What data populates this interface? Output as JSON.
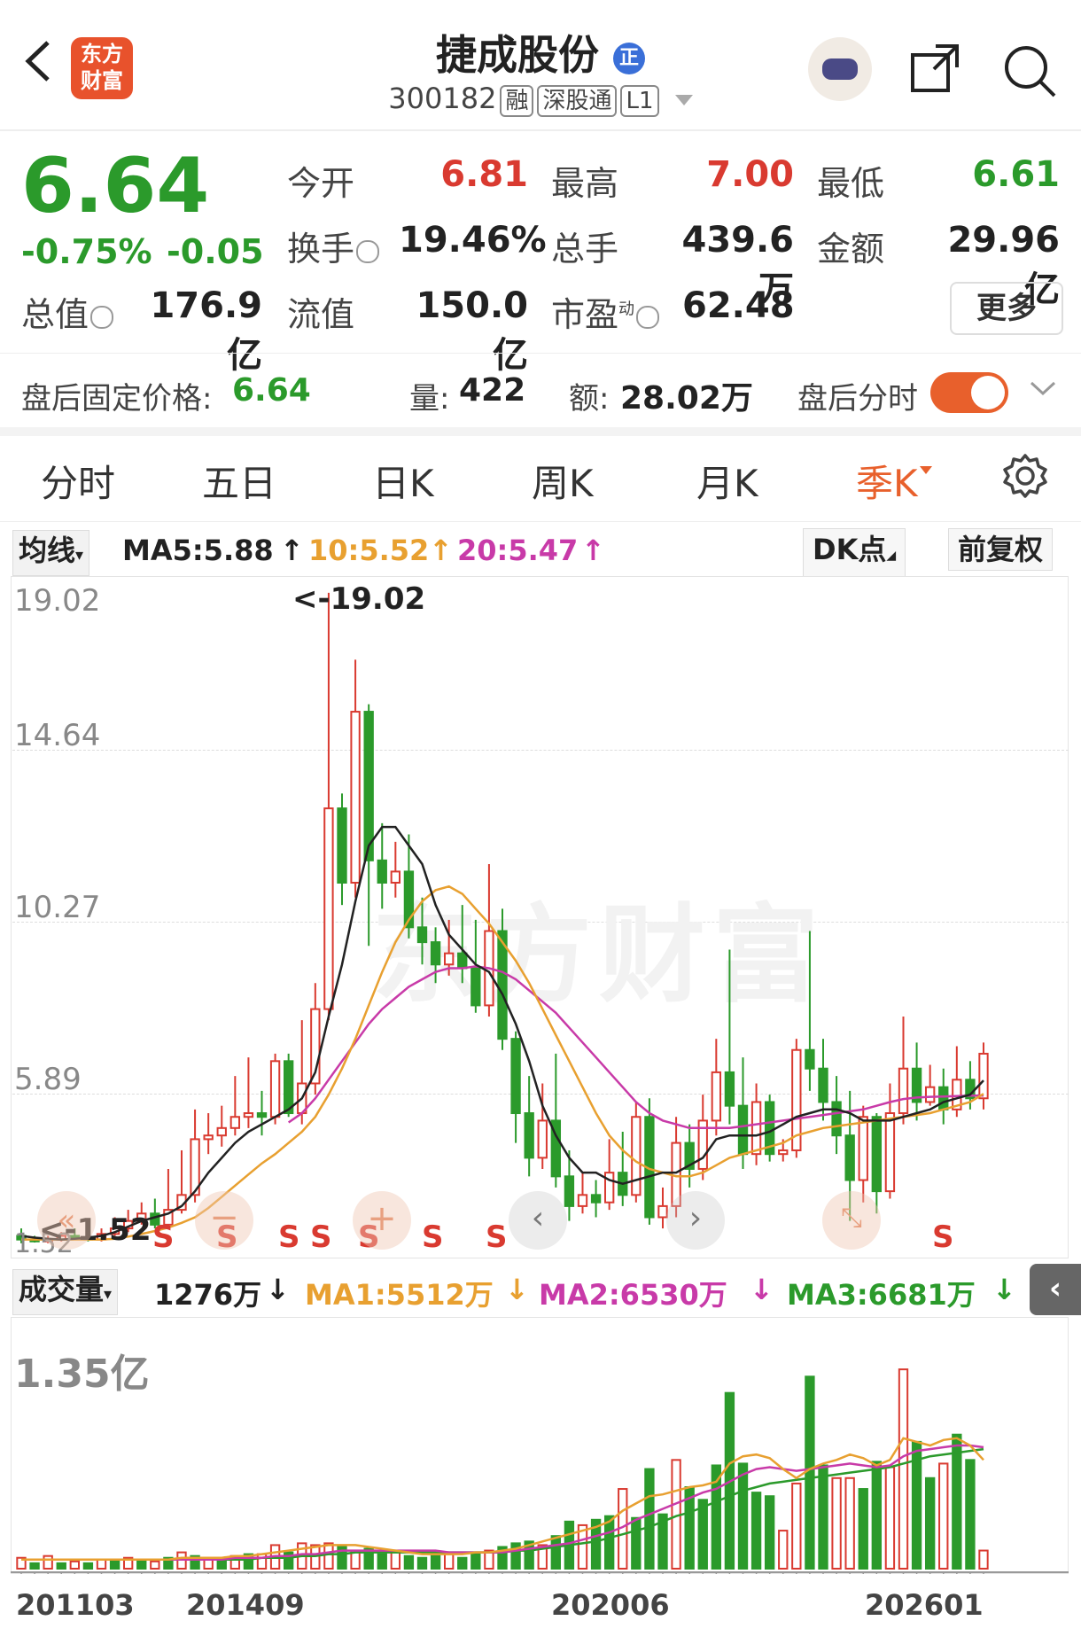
{
  "header": {
    "title": "捷成股份",
    "badge": "正",
    "code": "300182",
    "tags": [
      "融",
      "深股通",
      "L1"
    ],
    "logo_text": "东方财富"
  },
  "quote": {
    "price": "6.64",
    "change_pct": "-0.75%",
    "change": "-0.05",
    "rows": [
      [
        {
          "label": "今开",
          "value": "6.81",
          "color": "red"
        },
        {
          "label": "最高",
          "value": "7.00",
          "color": "red"
        },
        {
          "label": "最低",
          "value": "6.61",
          "color": "green"
        }
      ],
      [
        {
          "label": "换手",
          "value": "19.46%",
          "color": "black"
        },
        {
          "label": "总手",
          "value": "439.6万",
          "color": "black"
        },
        {
          "label": "金额",
          "value": "29.96亿",
          "color": "black"
        }
      ]
    ],
    "total_cap_label": "总值",
    "total_cap": "176.9亿",
    "float_cap_label": "流值",
    "float_cap": "150.0亿",
    "pe_label": "市盈",
    "pe_sup": "动",
    "pe": "62.48",
    "more": "更多"
  },
  "after_hours": {
    "price_label": "盘后固定价格:",
    "price": "6.64",
    "vol_label": "量:",
    "vol": "422",
    "amt_label": "额:",
    "amt": "28.02万",
    "toggle_label": "盘后分时"
  },
  "tabs": [
    "分时",
    "五日",
    "日K",
    "周K",
    "月K",
    "季K"
  ],
  "active_tab": "季K",
  "ma_bar": {
    "selector": "均线",
    "ma5": "MA5:5.88",
    "ma10": "10:5.52",
    "ma20": "20:5.47",
    "dk": "DK点",
    "fq": "前复权"
  },
  "vol_bar": {
    "selector": "成交量",
    "vol": "1276万",
    "ma1": "MA1:5512万",
    "ma2": "MA2:6530万",
    "ma3": "MA3:6681万"
  },
  "watermark": "东方财富",
  "colors": {
    "up": "#d93a30",
    "down": "#2b9a2b",
    "ma5": "#222222",
    "ma10": "#e8a030",
    "ma20": "#c83aa8",
    "accent": "#e8602c"
  },
  "chart_data": {
    "type": "candlestick",
    "price_axis_labels": [
      "19.02",
      "14.64",
      "10.27",
      "5.89",
      "1.52"
    ],
    "annotations": {
      "high": "<-19.02",
      "low": "<-1.52"
    },
    "s_marks": [
      "S",
      "S",
      "S",
      "S",
      "S",
      "S",
      "S",
      "S"
    ],
    "candles": [
      [
        1.7,
        1.6,
        1.9,
        1.5
      ],
      [
        1.6,
        1.55,
        1.7,
        1.52
      ],
      [
        1.55,
        1.6,
        1.7,
        1.5
      ],
      [
        1.6,
        1.7,
        1.8,
        1.55
      ],
      [
        1.7,
        1.65,
        1.9,
        1.6
      ],
      [
        1.65,
        1.6,
        1.8,
        1.55
      ],
      [
        1.6,
        1.75,
        1.9,
        1.55
      ],
      [
        1.75,
        1.9,
        2.2,
        1.7
      ],
      [
        1.9,
        2.1,
        2.4,
        1.8
      ],
      [
        2.1,
        2.3,
        2.6,
        2.0
      ],
      [
        2.3,
        2.0,
        2.7,
        1.9
      ],
      [
        2.0,
        2.4,
        3.5,
        1.9
      ],
      [
        2.4,
        2.8,
        4.0,
        2.3
      ],
      [
        2.8,
        4.3,
        5.1,
        2.6
      ],
      [
        4.3,
        4.4,
        5.0,
        3.9
      ],
      [
        4.4,
        4.6,
        5.2,
        4.1
      ],
      [
        4.6,
        4.9,
        6.0,
        4.4
      ],
      [
        4.9,
        5.0,
        6.5,
        4.6
      ],
      [
        5.0,
        4.9,
        5.6,
        4.4
      ],
      [
        4.9,
        6.4,
        6.6,
        4.7
      ],
      [
        6.4,
        5.0,
        6.6,
        4.9
      ],
      [
        5.0,
        5.8,
        7.5,
        4.7
      ],
      [
        5.8,
        7.8,
        8.5,
        5.5
      ],
      [
        7.8,
        13.2,
        19.0,
        7.5
      ],
      [
        13.2,
        11.2,
        13.6,
        10.6
      ],
      [
        11.2,
        15.8,
        17.2,
        10.8
      ],
      [
        15.8,
        11.8,
        16.0,
        9.5
      ],
      [
        11.8,
        11.2,
        12.8,
        10.5
      ],
      [
        11.2,
        11.5,
        12.3,
        10.8
      ],
      [
        11.5,
        10.0,
        12.5,
        9.7
      ],
      [
        10.0,
        9.6,
        10.8,
        9.0
      ],
      [
        9.6,
        9.0,
        10.0,
        8.5
      ],
      [
        9.0,
        9.3,
        10.2,
        8.7
      ],
      [
        9.3,
        8.9,
        10.6,
        8.5
      ],
      [
        8.9,
        7.9,
        10.2,
        7.7
      ],
      [
        7.9,
        9.9,
        11.7,
        7.6
      ],
      [
        9.9,
        7.0,
        10.5,
        6.7
      ],
      [
        7.0,
        5.0,
        7.2,
        4.2
      ],
      [
        5.0,
        3.8,
        6.0,
        3.3
      ],
      [
        3.8,
        4.8,
        5.8,
        3.5
      ],
      [
        4.8,
        3.3,
        6.6,
        3.0
      ],
      [
        3.3,
        2.5,
        4.0,
        2.1
      ],
      [
        2.5,
        2.8,
        3.4,
        2.3
      ],
      [
        2.8,
        2.6,
        3.2,
        2.2
      ],
      [
        2.6,
        3.4,
        4.3,
        2.4
      ],
      [
        3.4,
        2.8,
        4.5,
        2.5
      ],
      [
        2.8,
        4.9,
        5.3,
        2.6
      ],
      [
        4.9,
        2.2,
        5.4,
        2.0
      ],
      [
        2.2,
        2.5,
        3.0,
        1.9
      ],
      [
        2.5,
        4.2,
        4.9,
        2.2
      ],
      [
        4.2,
        3.5,
        4.7,
        3.0
      ],
      [
        3.5,
        4.8,
        5.5,
        3.2
      ],
      [
        4.8,
        6.1,
        7.0,
        4.4
      ],
      [
        6.1,
        5.2,
        9.4,
        4.7
      ],
      [
        5.2,
        3.9,
        6.5,
        3.5
      ],
      [
        3.9,
        5.3,
        5.8,
        3.6
      ],
      [
        5.3,
        3.9,
        5.5,
        3.7
      ],
      [
        3.9,
        4.0,
        4.3,
        3.7
      ],
      [
        4.0,
        6.7,
        7.0,
        3.8
      ],
      [
        6.7,
        6.2,
        9.9,
        5.6
      ],
      [
        6.2,
        5.3,
        7.0,
        4.8
      ],
      [
        5.3,
        4.4,
        6.0,
        3.9
      ],
      [
        4.4,
        3.2,
        5.6,
        2.1
      ],
      [
        3.2,
        4.9,
        5.2,
        2.6
      ],
      [
        4.9,
        2.9,
        5.0,
        2.3
      ],
      [
        2.9,
        5.0,
        5.8,
        2.7
      ],
      [
        5.0,
        6.2,
        7.6,
        4.7
      ],
      [
        6.2,
        5.3,
        6.9,
        4.8
      ],
      [
        5.3,
        5.7,
        6.3,
        5.2
      ],
      [
        5.7,
        5.1,
        6.2,
        4.7
      ],
      [
        5.1,
        5.9,
        6.8,
        4.9
      ],
      [
        5.9,
        5.4,
        6.4,
        5.1
      ],
      [
        5.4,
        6.6,
        6.9,
        5.1
      ]
    ],
    "ma5": [
      1.7,
      1.65,
      1.62,
      1.6,
      1.62,
      1.65,
      1.7,
      1.8,
      1.95,
      2.1,
      2.2,
      2.3,
      2.5,
      2.9,
      3.4,
      3.8,
      4.2,
      4.5,
      4.7,
      4.9,
      5.1,
      5.4,
      6.1,
      7.6,
      9.0,
      10.7,
      12.2,
      12.7,
      12.7,
      12.2,
      11.7,
      10.6,
      9.8,
      9.4,
      9.0,
      8.8,
      8.2,
      7.4,
      6.4,
      5.2,
      4.4,
      3.8,
      3.4,
      3.4,
      3.2,
      3.1,
      3.2,
      3.3,
      3.4,
      3.4,
      3.6,
      3.8,
      4.3,
      4.4,
      4.4,
      4.4,
      4.5,
      4.7,
      4.9,
      5.0,
      5.1,
      5.1,
      5.0,
      4.8,
      4.8,
      4.8,
      4.9,
      5.0,
      5.1,
      5.3,
      5.4,
      5.5,
      5.88
    ],
    "ma10": [
      1.6,
      1.6,
      1.6,
      1.6,
      1.6,
      1.6,
      1.6,
      1.62,
      1.68,
      1.75,
      1.83,
      1.92,
      2.05,
      2.2,
      2.45,
      2.75,
      3.05,
      3.35,
      3.65,
      3.9,
      4.2,
      4.5,
      4.9,
      5.5,
      6.2,
      7.0,
      7.9,
      8.8,
      9.6,
      10.2,
      10.7,
      11.0,
      11.1,
      10.9,
      10.5,
      10.1,
      9.6,
      9.1,
      8.5,
      7.8,
      7.1,
      6.4,
      5.7,
      5.0,
      4.4,
      4.0,
      3.7,
      3.5,
      3.4,
      3.3,
      3.3,
      3.4,
      3.6,
      3.8,
      3.9,
      4.0,
      4.1,
      4.2,
      4.4,
      4.5,
      4.6,
      4.65,
      4.7,
      4.75,
      4.8,
      4.85,
      4.9,
      4.95,
      5.0,
      5.1,
      5.2,
      5.3,
      5.52
    ],
    "ma20_start": 20,
    "ma20": [
      4.75,
      5.0,
      5.4,
      5.9,
      6.4,
      6.9,
      7.4,
      7.8,
      8.1,
      8.4,
      8.6,
      8.8,
      8.9,
      8.9,
      8.95,
      8.9,
      8.8,
      8.6,
      8.3,
      8.0,
      7.7,
      7.3,
      6.9,
      6.5,
      6.1,
      5.7,
      5.3,
      5.0,
      4.8,
      4.7,
      4.6,
      4.6,
      4.6,
      4.6,
      4.65,
      4.7,
      4.75,
      4.8,
      4.85,
      4.9,
      4.95,
      5.0,
      5.05,
      5.1,
      5.2,
      5.3,
      5.38,
      5.42,
      5.44,
      5.45,
      5.46,
      5.47,
      5.47
    ],
    "volume": {
      "axis_label": "1.35亿",
      "x_tick_labels": [
        "201103",
        "201409",
        "202006",
        "202601"
      ],
      "bars": [
        {
          "v": 0.06,
          "up": true
        },
        {
          "v": 0.03,
          "up": false
        },
        {
          "v": 0.07,
          "up": true
        },
        {
          "v": 0.03,
          "up": false
        },
        {
          "v": 0.04,
          "up": true
        },
        {
          "v": 0.03,
          "up": false
        },
        {
          "v": 0.05,
          "up": true
        },
        {
          "v": 0.04,
          "up": false
        },
        {
          "v": 0.06,
          "up": true
        },
        {
          "v": 0.05,
          "up": false
        },
        {
          "v": 0.04,
          "up": true
        },
        {
          "v": 0.06,
          "up": false
        },
        {
          "v": 0.09,
          "up": true
        },
        {
          "v": 0.07,
          "up": false
        },
        {
          "v": 0.06,
          "up": true
        },
        {
          "v": 0.05,
          "up": false
        },
        {
          "v": 0.07,
          "up": true
        },
        {
          "v": 0.08,
          "up": false
        },
        {
          "v": 0.08,
          "up": true
        },
        {
          "v": 0.13,
          "up": true
        },
        {
          "v": 0.09,
          "up": false
        },
        {
          "v": 0.14,
          "up": true
        },
        {
          "v": 0.13,
          "up": true
        },
        {
          "v": 0.14,
          "up": true
        },
        {
          "v": 0.12,
          "up": false
        },
        {
          "v": 0.1,
          "up": true
        },
        {
          "v": 0.11,
          "up": false
        },
        {
          "v": 0.08,
          "up": false
        },
        {
          "v": 0.09,
          "up": true
        },
        {
          "v": 0.07,
          "up": false
        },
        {
          "v": 0.06,
          "up": false
        },
        {
          "v": 0.07,
          "up": false
        },
        {
          "v": 0.08,
          "up": true
        },
        {
          "v": 0.06,
          "up": false
        },
        {
          "v": 0.09,
          "up": false
        },
        {
          "v": 0.1,
          "up": true
        },
        {
          "v": 0.12,
          "up": false
        },
        {
          "v": 0.14,
          "up": false
        },
        {
          "v": 0.15,
          "up": false
        },
        {
          "v": 0.13,
          "up": true
        },
        {
          "v": 0.18,
          "up": false
        },
        {
          "v": 0.26,
          "up": false
        },
        {
          "v": 0.24,
          "up": true
        },
        {
          "v": 0.27,
          "up": false
        },
        {
          "v": 0.29,
          "up": false
        },
        {
          "v": 0.44,
          "up": true
        },
        {
          "v": 0.28,
          "up": false
        },
        {
          "v": 0.55,
          "up": false
        },
        {
          "v": 0.3,
          "up": false
        },
        {
          "v": 0.6,
          "up": true
        },
        {
          "v": 0.45,
          "up": false
        },
        {
          "v": 0.38,
          "up": false
        },
        {
          "v": 0.57,
          "up": false
        },
        {
          "v": 0.97,
          "up": false
        },
        {
          "v": 0.58,
          "up": false
        },
        {
          "v": 0.42,
          "up": false
        },
        {
          "v": 0.4,
          "up": false
        },
        {
          "v": 0.21,
          "up": true
        },
        {
          "v": 0.47,
          "up": true
        },
        {
          "v": 1.06,
          "up": false
        },
        {
          "v": 0.57,
          "up": false
        },
        {
          "v": 0.5,
          "up": true
        },
        {
          "v": 0.5,
          "up": true
        },
        {
          "v": 0.44,
          "up": false
        },
        {
          "v": 0.59,
          "up": false
        },
        {
          "v": 0.56,
          "up": true
        },
        {
          "v": 1.1,
          "up": true
        },
        {
          "v": 0.7,
          "up": false
        },
        {
          "v": 0.5,
          "up": false
        },
        {
          "v": 0.58,
          "up": true
        },
        {
          "v": 0.74,
          "up": false
        },
        {
          "v": 0.6,
          "up": false
        },
        {
          "v": 0.1,
          "up": true
        }
      ],
      "ma1": [
        0.05,
        0.05,
        0.05,
        0.05,
        0.05,
        0.05,
        0.05,
        0.05,
        0.05,
        0.05,
        0.05,
        0.05,
        0.06,
        0.06,
        0.06,
        0.06,
        0.07,
        0.07,
        0.08,
        0.09,
        0.1,
        0.11,
        0.12,
        0.13,
        0.13,
        0.13,
        0.12,
        0.11,
        0.1,
        0.09,
        0.08,
        0.08,
        0.08,
        0.08,
        0.09,
        0.09,
        0.1,
        0.11,
        0.13,
        0.15,
        0.17,
        0.19,
        0.21,
        0.23,
        0.26,
        0.32,
        0.36,
        0.4,
        0.41,
        0.43,
        0.45,
        0.46,
        0.48,
        0.58,
        0.62,
        0.63,
        0.61,
        0.55,
        0.5,
        0.55,
        0.58,
        0.6,
        0.63,
        0.61,
        0.57,
        0.6,
        0.72,
        0.7,
        0.68,
        0.71,
        0.72,
        0.68,
        0.6
      ],
      "ma2": [
        0.05,
        0.05,
        0.05,
        0.05,
        0.05,
        0.05,
        0.05,
        0.05,
        0.05,
        0.05,
        0.05,
        0.05,
        0.05,
        0.05,
        0.05,
        0.05,
        0.06,
        0.06,
        0.06,
        0.07,
        0.07,
        0.08,
        0.08,
        0.09,
        0.1,
        0.1,
        0.1,
        0.1,
        0.1,
        0.1,
        0.1,
        0.1,
        0.09,
        0.09,
        0.09,
        0.09,
        0.09,
        0.1,
        0.11,
        0.12,
        0.13,
        0.14,
        0.16,
        0.18,
        0.2,
        0.23,
        0.27,
        0.3,
        0.33,
        0.36,
        0.39,
        0.42,
        0.44,
        0.48,
        0.52,
        0.55,
        0.56,
        0.55,
        0.54,
        0.55,
        0.56,
        0.57,
        0.58,
        0.57,
        0.56,
        0.57,
        0.62,
        0.65,
        0.66,
        0.67,
        0.68,
        0.68,
        0.67
      ],
      "ma3": [
        0.05,
        0.05,
        0.05,
        0.05,
        0.05,
        0.05,
        0.05,
        0.05,
        0.05,
        0.05,
        0.05,
        0.05,
        0.05,
        0.05,
        0.05,
        0.05,
        0.05,
        0.05,
        0.06,
        0.06,
        0.06,
        0.07,
        0.07,
        0.08,
        0.08,
        0.09,
        0.09,
        0.09,
        0.09,
        0.09,
        0.09,
        0.09,
        0.09,
        0.09,
        0.09,
        0.09,
        0.09,
        0.1,
        0.1,
        0.11,
        0.12,
        0.13,
        0.14,
        0.15,
        0.17,
        0.19,
        0.21,
        0.23,
        0.26,
        0.29,
        0.31,
        0.34,
        0.37,
        0.4,
        0.43,
        0.45,
        0.47,
        0.48,
        0.49,
        0.5,
        0.51,
        0.52,
        0.53,
        0.54,
        0.55,
        0.56,
        0.58,
        0.6,
        0.62,
        0.63,
        0.64,
        0.65,
        0.66
      ],
      "ylim": [
        0,
        1.35
      ]
    },
    "ylim": [
      1.52,
      19.02
    ]
  }
}
